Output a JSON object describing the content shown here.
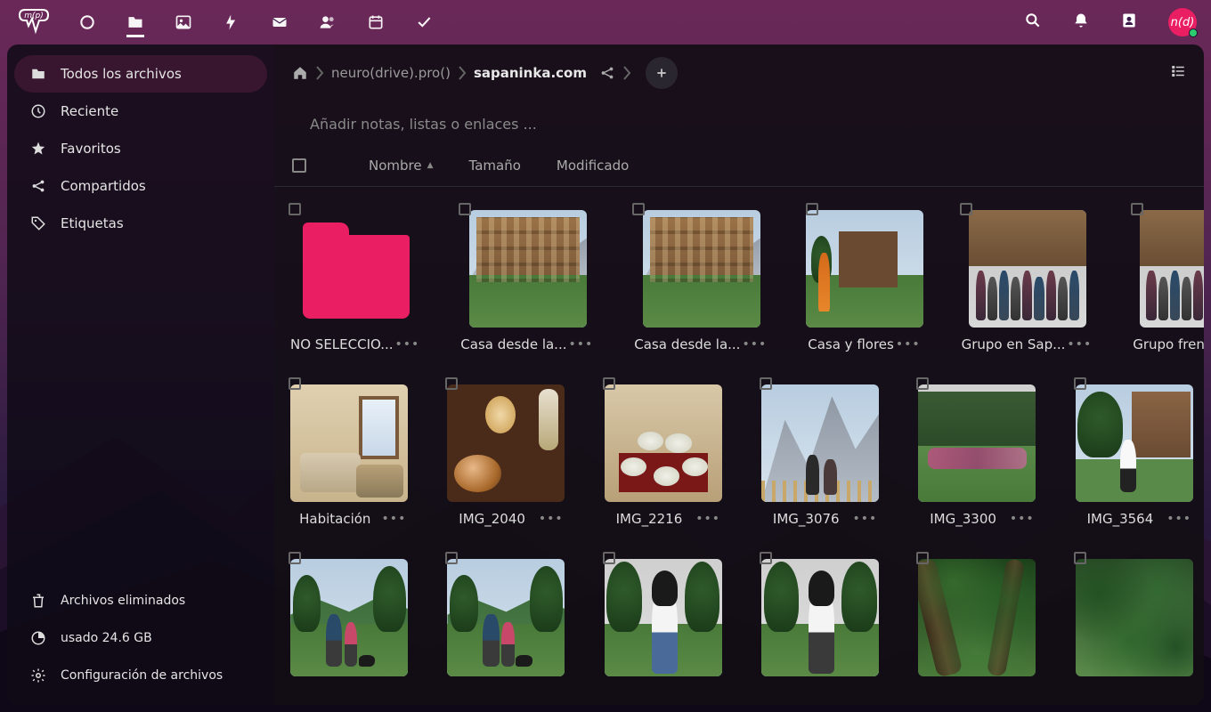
{
  "topnav": {
    "brand": "m(p)",
    "icons": [
      "dashboard",
      "files",
      "photos",
      "activity",
      "mail",
      "contacts",
      "calendar",
      "tasks"
    ]
  },
  "topright": {
    "icons": [
      "search",
      "notifications",
      "contacts-menu"
    ],
    "avatar_text": "n(d)"
  },
  "sidebar": {
    "items": [
      {
        "icon": "folder",
        "label": "Todos los archivos",
        "active": true
      },
      {
        "icon": "clock",
        "label": "Reciente",
        "active": false
      },
      {
        "icon": "star",
        "label": "Favoritos",
        "active": false
      },
      {
        "icon": "share",
        "label": "Compartidos",
        "active": false
      },
      {
        "icon": "tag",
        "label": "Etiquetas",
        "active": false
      }
    ],
    "footer": [
      {
        "icon": "trash",
        "label": "Archivos eliminados"
      },
      {
        "icon": "pie",
        "label": "usado 24.6 GB"
      },
      {
        "icon": "gear",
        "label": "Configuración de archivos"
      }
    ]
  },
  "breadcrumbs": {
    "root": "neuro(drive).pro()",
    "current": "sapaninka.com"
  },
  "notes_placeholder": "Añadir notas, listas o enlaces ...",
  "columns": {
    "name": "Nombre",
    "size": "Tamaño",
    "modified": "Modificado"
  },
  "files": [
    {
      "type": "folder",
      "label": "NO SELECCIO..."
    },
    {
      "type": "img",
      "variant": "casa",
      "label": "Casa desde la..."
    },
    {
      "type": "img",
      "variant": "casa",
      "label": "Casa desde la..."
    },
    {
      "type": "img",
      "variant": "flores",
      "label": "Casa y flores"
    },
    {
      "type": "img",
      "variant": "grupo",
      "label": "Grupo en Sap..."
    },
    {
      "type": "img",
      "variant": "grupo",
      "label": "Grupo frente ..."
    },
    {
      "type": "img",
      "variant": "room",
      "label": "Habitación"
    },
    {
      "type": "img",
      "variant": "meal",
      "label": "IMG_2040"
    },
    {
      "type": "img",
      "variant": "table",
      "label": "IMG_2216"
    },
    {
      "type": "img",
      "variant": "vista",
      "label": "IMG_3076"
    },
    {
      "type": "img",
      "variant": "garden",
      "label": "IMG_3300"
    },
    {
      "type": "img",
      "variant": "stand",
      "label": "IMG_3564"
    },
    {
      "type": "img",
      "variant": "walk",
      "label": ""
    },
    {
      "type": "img",
      "variant": "walk",
      "label": ""
    },
    {
      "type": "img",
      "variant": "port-a",
      "label": ""
    },
    {
      "type": "img",
      "variant": "port-b",
      "label": ""
    },
    {
      "type": "img",
      "variant": "jungle",
      "label": ""
    },
    {
      "type": "img",
      "variant": "jwide",
      "label": ""
    }
  ]
}
